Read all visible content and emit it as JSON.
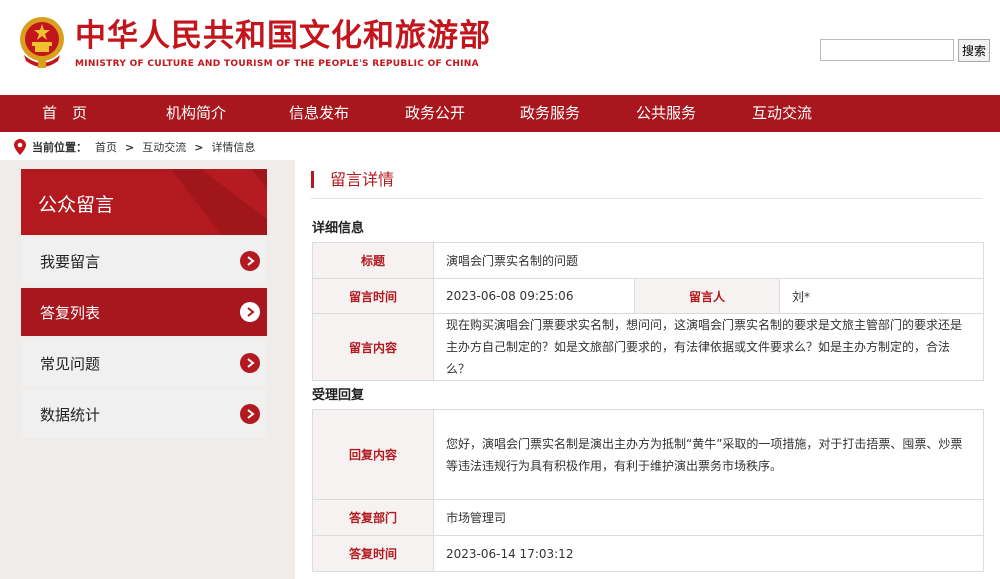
{
  "header": {
    "title_cn": "中华人民共和国文化和旅游部",
    "title_en": "MINISTRY OF CULTURE AND TOURISM OF THE PEOPLE'S REPUBLIC OF CHINA",
    "search_value": "",
    "search_button": "搜索",
    "brand_color": "#c3161c",
    "emblem_icon": "national-emblem-icon"
  },
  "nav": {
    "items": [
      "首　页",
      "机构简介",
      "信息发布",
      "政务公开",
      "政务服务",
      "公共服务",
      "互动交流"
    ]
  },
  "breadcrumb": {
    "label": "当前位置：",
    "items": [
      "首页",
      "互动交流",
      "详情信息"
    ],
    "separator": ">",
    "icon": "location-pin-icon"
  },
  "sidebar": {
    "title": "公众留言",
    "items": [
      {
        "label": "我要留言",
        "active": false
      },
      {
        "label": "答复列表",
        "active": true
      },
      {
        "label": "常见问题",
        "active": false
      },
      {
        "label": "数据统计",
        "active": false
      }
    ],
    "arrow_icon": "chevron-right-icon"
  },
  "main": {
    "title": "留言详情",
    "detail_section": "详细信息",
    "reply_section": "受理回复",
    "fields": {
      "subject_label": "标题",
      "subject_value": "演唱会门票实名制的问题",
      "time_label": "留言时间",
      "time_value": "2023-06-08 09:25:06",
      "author_label": "留言人",
      "author_value": "刘*",
      "content_label": "留言内容",
      "content_value": "现在购买演唱会门票要求实名制，想问问，这演唱会门票实名制的要求是文旅主管部门的要求还是主办方自己制定的？如是文旅部门要求的，有法律依据或文件要求么？如是主办方制定的，合法么？",
      "reply_label": "回复内容",
      "reply_value": "您好，演唱会门票实名制是演出主办方为抵制“黄牛”采取的一项措施，对于打击捂票、囤票、炒票等违法违规行为具有积极作用，有利于维护演出票务市场秩序。",
      "dept_label": "答复部门",
      "dept_value": "市场管理司",
      "reply_time_label": "答复时间",
      "reply_time_value": "2023-06-14 17:03:12"
    },
    "accent_color": "#b21a20"
  }
}
